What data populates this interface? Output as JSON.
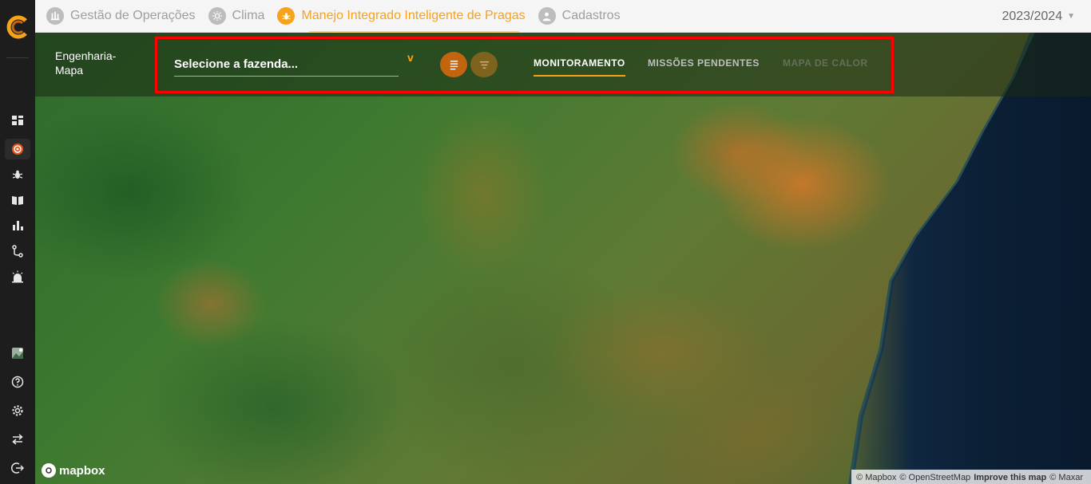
{
  "topbar": {
    "tabs": [
      {
        "label": "Gestão de Operações",
        "icon": "operations-icon",
        "active": false
      },
      {
        "label": "Clima",
        "icon": "sun-icon",
        "active": false
      },
      {
        "label": "Manejo Integrado Inteligente de Pragas",
        "icon": "bug-icon",
        "active": true
      },
      {
        "label": "Cadastros",
        "icon": "user-icon",
        "active": false
      }
    ],
    "season": "2023/2024"
  },
  "header": {
    "title": "Engenharia-Mapa",
    "farm_select_placeholder": "Selecione a fazenda...",
    "farm_select_caret": "v",
    "nav": {
      "monitoramento": "MONITORAMENTO",
      "missoes": "MISSÕES PENDENTES",
      "mapa": "MAPA DE CALOR"
    }
  },
  "sidebar": {
    "items": [
      {
        "icon": "dashboard-icon"
      },
      {
        "icon": "target-icon",
        "active": true
      },
      {
        "icon": "bug-icon"
      },
      {
        "icon": "book-icon"
      },
      {
        "icon": "bar-chart-icon"
      },
      {
        "icon": "route-icon"
      },
      {
        "icon": "alarm-icon"
      },
      {
        "icon": "avatar-icon"
      },
      {
        "icon": "help-icon"
      },
      {
        "icon": "settings-icon"
      },
      {
        "icon": "swap-icon"
      },
      {
        "icon": "logout-icon"
      }
    ]
  },
  "map": {
    "logo": "mapbox",
    "attribution": {
      "mapbox": "© Mapbox",
      "osm": "© OpenStreetMap",
      "improve": "Improve this map",
      "maxar": "© Maxar"
    }
  },
  "colors": {
    "accent": "#f7a21b",
    "sidebar_bg": "#1d1d1d",
    "highlight": "#ff0000"
  }
}
